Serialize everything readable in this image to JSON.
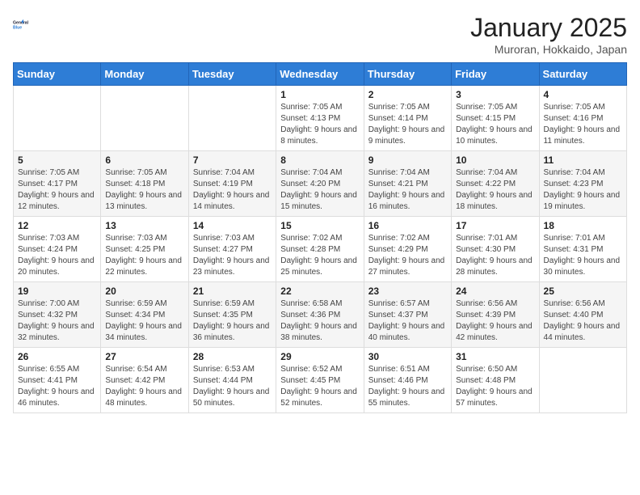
{
  "header": {
    "logo_line1": "General",
    "logo_line2": "Blue",
    "title": "January 2025",
    "subtitle": "Muroran, Hokkaido, Japan"
  },
  "days_of_week": [
    "Sunday",
    "Monday",
    "Tuesday",
    "Wednesday",
    "Thursday",
    "Friday",
    "Saturday"
  ],
  "weeks": [
    [
      {
        "day": "",
        "sunrise": "",
        "sunset": "",
        "daylight": ""
      },
      {
        "day": "",
        "sunrise": "",
        "sunset": "",
        "daylight": ""
      },
      {
        "day": "",
        "sunrise": "",
        "sunset": "",
        "daylight": ""
      },
      {
        "day": "1",
        "sunrise": "7:05 AM",
        "sunset": "4:13 PM",
        "daylight": "9 hours and 8 minutes."
      },
      {
        "day": "2",
        "sunrise": "7:05 AM",
        "sunset": "4:14 PM",
        "daylight": "9 hours and 9 minutes."
      },
      {
        "day": "3",
        "sunrise": "7:05 AM",
        "sunset": "4:15 PM",
        "daylight": "9 hours and 10 minutes."
      },
      {
        "day": "4",
        "sunrise": "7:05 AM",
        "sunset": "4:16 PM",
        "daylight": "9 hours and 11 minutes."
      }
    ],
    [
      {
        "day": "5",
        "sunrise": "7:05 AM",
        "sunset": "4:17 PM",
        "daylight": "9 hours and 12 minutes."
      },
      {
        "day": "6",
        "sunrise": "7:05 AM",
        "sunset": "4:18 PM",
        "daylight": "9 hours and 13 minutes."
      },
      {
        "day": "7",
        "sunrise": "7:04 AM",
        "sunset": "4:19 PM",
        "daylight": "9 hours and 14 minutes."
      },
      {
        "day": "8",
        "sunrise": "7:04 AM",
        "sunset": "4:20 PM",
        "daylight": "9 hours and 15 minutes."
      },
      {
        "day": "9",
        "sunrise": "7:04 AM",
        "sunset": "4:21 PM",
        "daylight": "9 hours and 16 minutes."
      },
      {
        "day": "10",
        "sunrise": "7:04 AM",
        "sunset": "4:22 PM",
        "daylight": "9 hours and 18 minutes."
      },
      {
        "day": "11",
        "sunrise": "7:04 AM",
        "sunset": "4:23 PM",
        "daylight": "9 hours and 19 minutes."
      }
    ],
    [
      {
        "day": "12",
        "sunrise": "7:03 AM",
        "sunset": "4:24 PM",
        "daylight": "9 hours and 20 minutes."
      },
      {
        "day": "13",
        "sunrise": "7:03 AM",
        "sunset": "4:25 PM",
        "daylight": "9 hours and 22 minutes."
      },
      {
        "day": "14",
        "sunrise": "7:03 AM",
        "sunset": "4:27 PM",
        "daylight": "9 hours and 23 minutes."
      },
      {
        "day": "15",
        "sunrise": "7:02 AM",
        "sunset": "4:28 PM",
        "daylight": "9 hours and 25 minutes."
      },
      {
        "day": "16",
        "sunrise": "7:02 AM",
        "sunset": "4:29 PM",
        "daylight": "9 hours and 27 minutes."
      },
      {
        "day": "17",
        "sunrise": "7:01 AM",
        "sunset": "4:30 PM",
        "daylight": "9 hours and 28 minutes."
      },
      {
        "day": "18",
        "sunrise": "7:01 AM",
        "sunset": "4:31 PM",
        "daylight": "9 hours and 30 minutes."
      }
    ],
    [
      {
        "day": "19",
        "sunrise": "7:00 AM",
        "sunset": "4:32 PM",
        "daylight": "9 hours and 32 minutes."
      },
      {
        "day": "20",
        "sunrise": "6:59 AM",
        "sunset": "4:34 PM",
        "daylight": "9 hours and 34 minutes."
      },
      {
        "day": "21",
        "sunrise": "6:59 AM",
        "sunset": "4:35 PM",
        "daylight": "9 hours and 36 minutes."
      },
      {
        "day": "22",
        "sunrise": "6:58 AM",
        "sunset": "4:36 PM",
        "daylight": "9 hours and 38 minutes."
      },
      {
        "day": "23",
        "sunrise": "6:57 AM",
        "sunset": "4:37 PM",
        "daylight": "9 hours and 40 minutes."
      },
      {
        "day": "24",
        "sunrise": "6:56 AM",
        "sunset": "4:39 PM",
        "daylight": "9 hours and 42 minutes."
      },
      {
        "day": "25",
        "sunrise": "6:56 AM",
        "sunset": "4:40 PM",
        "daylight": "9 hours and 44 minutes."
      }
    ],
    [
      {
        "day": "26",
        "sunrise": "6:55 AM",
        "sunset": "4:41 PM",
        "daylight": "9 hours and 46 minutes."
      },
      {
        "day": "27",
        "sunrise": "6:54 AM",
        "sunset": "4:42 PM",
        "daylight": "9 hours and 48 minutes."
      },
      {
        "day": "28",
        "sunrise": "6:53 AM",
        "sunset": "4:44 PM",
        "daylight": "9 hours and 50 minutes."
      },
      {
        "day": "29",
        "sunrise": "6:52 AM",
        "sunset": "4:45 PM",
        "daylight": "9 hours and 52 minutes."
      },
      {
        "day": "30",
        "sunrise": "6:51 AM",
        "sunset": "4:46 PM",
        "daylight": "9 hours and 55 minutes."
      },
      {
        "day": "31",
        "sunrise": "6:50 AM",
        "sunset": "4:48 PM",
        "daylight": "9 hours and 57 minutes."
      },
      {
        "day": "",
        "sunrise": "",
        "sunset": "",
        "daylight": ""
      }
    ]
  ]
}
